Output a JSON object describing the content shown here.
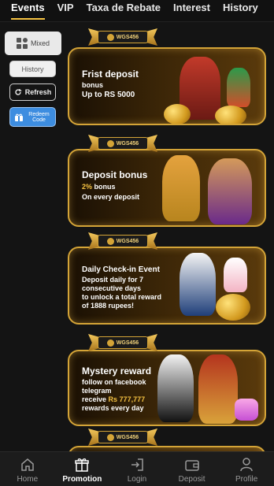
{
  "tabs": [
    "Events",
    "VIP",
    "Taxa de Rebate",
    "Interest",
    "History"
  ],
  "side": {
    "mixed": "Mixed",
    "history": "History",
    "refresh": "Refresh",
    "redeem": "Redeem Code"
  },
  "brand": "WGS456",
  "banners": [
    {
      "title": "Frist deposit",
      "lines": [
        "bonus",
        "Up to RS 5000"
      ]
    },
    {
      "title": "Deposit bonus",
      "highlight": "2%",
      "lines": [
        "bonus",
        "On every deposit"
      ]
    },
    {
      "title": "Daily Check-in Event",
      "lines": [
        "Deposit daily for 7",
        "consecutive days",
        "to unlock a total reward",
        "of 1888 rupees!"
      ]
    },
    {
      "title": "Mystery reward",
      "lines": [
        "follow on facebook",
        "telegram"
      ],
      "receive": "receive",
      "amount": "Rs 777,777",
      "last": "rewards every day"
    }
  ],
  "nav": [
    "Home",
    "Promotion",
    "Login",
    "Deposit",
    "Profile"
  ],
  "colors": {
    "accent": "#f5c242",
    "border": "#d4a437",
    "redeem": "#3d8de0"
  }
}
